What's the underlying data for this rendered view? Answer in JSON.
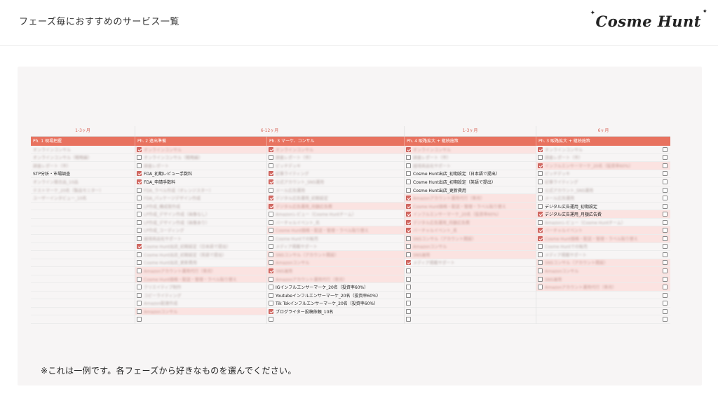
{
  "header": {
    "title": "フェーズ毎におすすめのサービス一覧",
    "logo": "Cosme Hunt",
    "sparkle": "✦"
  },
  "table": {
    "durations": [
      "1-3ヶ月",
      "6-12ヶ月",
      "1-3ヶ月",
      "6ヶ月"
    ],
    "phases": [
      "Ph. 1 現場把握",
      "Ph. 2 進出準備",
      "Ph. 3 マーケ、コンサル",
      "Ph. 4 販路拡大 + 継続施策",
      "Ph. 3 販路拡大 + 継続施策"
    ],
    "col1": [
      {
        "t": "オンラインコンサル",
        "b": true
      },
      {
        "t": "オンラインコンサル（戦略編）",
        "b": true
      },
      {
        "t": "調査レポート（市）",
        "b": true
      },
      {
        "t": "STP分析・市場調査",
        "b": false
      },
      {
        "t": "オンライン競合品_10品",
        "b": true
      },
      {
        "t": "テストマーケ_20名（製品モニター）",
        "b": true
      },
      {
        "t": "ユーザーインタビュー_10名",
        "b": true
      }
    ],
    "col2": [
      {
        "t": "オンラインコンサル",
        "b": true,
        "c": true,
        "h": true
      },
      {
        "t": "オンラインコンサル（戦略編）",
        "b": true,
        "c": false,
        "h": false
      },
      {
        "t": "調査レポート",
        "b": true,
        "c": false,
        "h": false
      },
      {
        "t": "FDA_初期レビュー手数料",
        "b": false,
        "c": true,
        "h": false
      },
      {
        "t": "FDA_申請手数料",
        "b": false,
        "c": true,
        "h": false
      },
      {
        "t": "FDA_ラベル作成（オレンジスター）",
        "b": true,
        "c": false,
        "h": false
      },
      {
        "t": "FDA_パッケージデザイン作成",
        "b": true,
        "c": false,
        "h": false
      },
      {
        "t": "LP作成_構成案作成",
        "b": true,
        "c": false,
        "h": false
      },
      {
        "t": "LP作成_デザイン作成（画像なし）",
        "b": true,
        "c": false,
        "h": false
      },
      {
        "t": "LP作成_デザイン作成（画像あり）",
        "b": true,
        "c": false,
        "h": false
      },
      {
        "t": "LP作成_コーディング",
        "b": true,
        "c": false,
        "h": false
      },
      {
        "t": "越境商品化サポート",
        "b": true,
        "c": false,
        "h": false
      },
      {
        "t": "Cosme Hunt出店_初期設定（日本語で提出）",
        "b": true,
        "c": true,
        "h": false
      },
      {
        "t": "Cosme Hunt出店_初期設定（英語で提出）",
        "b": true,
        "c": false,
        "h": false
      },
      {
        "t": "Cosme Hunt出店_更新費用",
        "b": true,
        "c": false,
        "h": false
      },
      {
        "t": "Amazonアカウント運用代行（単月）",
        "b": true,
        "c": false,
        "h": true
      },
      {
        "t": "Cosme Hunt価格・配送・管理・ラベル貼り替え",
        "b": true,
        "c": false,
        "h": true
      },
      {
        "t": "クリエイティブ制作",
        "b": true,
        "c": false,
        "h": false
      },
      {
        "t": "コピーライティング",
        "b": true,
        "c": false,
        "h": false
      },
      {
        "t": "Amazon配達作成",
        "b": true,
        "c": false,
        "h": false
      },
      {
        "t": "Amazonコンサル",
        "b": true,
        "c": false,
        "h": true
      }
    ],
    "col3": [
      {
        "t": "オンラインコンサル",
        "b": true,
        "c": true,
        "h": true
      },
      {
        "t": "調査レポート（市）",
        "b": true,
        "c": false,
        "h": false
      },
      {
        "t": "ピッチデッキ",
        "b": true,
        "c": false,
        "h": false
      },
      {
        "t": "記事ライティング",
        "b": true,
        "c": true,
        "h": false
      },
      {
        "t": "公式アカウント_SNS運用",
        "b": true,
        "c": true,
        "h": false
      },
      {
        "t": "メール広告運用",
        "b": true,
        "c": false,
        "h": false
      },
      {
        "t": "デジタル広告運用_初期設定",
        "b": true,
        "c": true,
        "h": false
      },
      {
        "t": "デジタル広告運用_月額広告費",
        "b": true,
        "c": true,
        "h": true
      },
      {
        "t": "Amazonレビュー（Cosme Huntチーム）",
        "b": true,
        "c": false,
        "h": false
      },
      {
        "t": "バーチャルイベント_名",
        "b": true,
        "c": false,
        "h": false
      },
      {
        "t": "Cosme Hunt価格・配送・管理・ラベル貼り替え",
        "b": true,
        "c": false,
        "h": true
      },
      {
        "t": "Cosme Huntでの販売",
        "b": true,
        "c": false,
        "h": false
      },
      {
        "t": "メディア掲載サポート",
        "b": true,
        "c": false,
        "h": false
      },
      {
        "t": "SNSコンサル（アカウント開設）",
        "b": true,
        "c": false,
        "h": true
      },
      {
        "t": "Amazonコンサル",
        "b": true,
        "c": false,
        "h": true
      },
      {
        "t": "SNS運用",
        "b": true,
        "c": true,
        "h": true
      },
      {
        "t": "Amazonアカウント運用代行（単月）",
        "b": true,
        "c": false,
        "h": true
      },
      {
        "t": "IGインフルエンサーマーケ_20名（投資率60%）",
        "b": false,
        "c": false,
        "h": false
      },
      {
        "t": "Youtubeインフルエンサーマーケ_20名（投資率60%）",
        "b": false,
        "c": false,
        "h": false
      },
      {
        "t": "Tik Tokインフルエンサーマーケ_20名（投資率60%）",
        "b": false,
        "c": false,
        "h": false
      },
      {
        "t": "ブログライター投稿依頼_10名",
        "b": false,
        "c": true,
        "h": false
      }
    ],
    "col4": [
      {
        "t": "オンラインコンサル",
        "b": true,
        "c": true,
        "h": true
      },
      {
        "t": "調査レポート（市）",
        "b": true,
        "c": false,
        "h": false
      },
      {
        "t": "越境商品化サポート",
        "b": true,
        "c": false,
        "h": false
      },
      {
        "t": "Cosme Hunt出店_初期設定（日本語で提出）",
        "b": false,
        "c": false,
        "h": false
      },
      {
        "t": "Cosme Hunt出店_初期設定（英語で提出）",
        "b": false,
        "c": false,
        "h": false
      },
      {
        "t": "Cosme Hunt出店_更新費用",
        "b": false,
        "c": false,
        "h": false
      },
      {
        "t": "Amazonアカウント運用代行（単月）",
        "b": true,
        "c": true,
        "h": true
      },
      {
        "t": "Cosme Hunt価格・配送・管理・ラベル貼り替え",
        "b": true,
        "c": true,
        "h": true
      },
      {
        "t": "インフルエンサーマーケ_20名（投資率60%）",
        "b": true,
        "c": true,
        "h": true
      },
      {
        "t": "デジタル広告運用_月額広告費",
        "b": true,
        "c": true,
        "h": true
      },
      {
        "t": "バーチャルイベント_名",
        "b": true,
        "c": true,
        "h": true
      },
      {
        "t": "SNSコンサル（アカウント開設）",
        "b": true,
        "c": false,
        "h": true
      },
      {
        "t": "Amazonコンサル",
        "b": true,
        "c": false,
        "h": true
      },
      {
        "t": "SNS運用",
        "b": true,
        "c": false,
        "h": true
      },
      {
        "t": "メディア掲載サポート",
        "b": true,
        "c": true,
        "h": false
      }
    ],
    "col5": [
      {
        "t": "オンラインコンサル",
        "b": true,
        "c": true,
        "h": false
      },
      {
        "t": "調査レポート（市）",
        "b": true,
        "c": false,
        "h": false
      },
      {
        "t": "インフルエンサーマーケ_20名（投資率60%）",
        "b": true,
        "c": true,
        "h": true
      },
      {
        "t": "ピッチデッキ",
        "b": true,
        "c": false,
        "h": false
      },
      {
        "t": "記事ライティング",
        "b": true,
        "c": false,
        "h": false
      },
      {
        "t": "公式アカウント_SNS運用",
        "b": true,
        "c": false,
        "h": false
      },
      {
        "t": "メール広告運用",
        "b": true,
        "c": false,
        "h": false
      },
      {
        "t": "デジタル広告運用_初期設定",
        "b": false,
        "c": false,
        "h": false
      },
      {
        "t": "デジタル広告運用_月額広告費",
        "b": false,
        "c": true,
        "h": true
      },
      {
        "t": "Amazonレビュー（Cosme Huntチーム）",
        "b": true,
        "c": false,
        "h": false
      },
      {
        "t": "バーチャルイベント",
        "b": true,
        "c": true,
        "h": true
      },
      {
        "t": "Cosme Hunt価格・配送・管理・ラベル貼り替え",
        "b": true,
        "c": true,
        "h": true
      },
      {
        "t": "Cosme Huntでの販売",
        "b": true,
        "c": false,
        "h": false
      },
      {
        "t": "メディア掲載サポート",
        "b": true,
        "c": false,
        "h": false
      },
      {
        "t": "SNSコンサル（アカウント開設）",
        "b": true,
        "c": false,
        "h": true
      },
      {
        "t": "Amazonコンサル",
        "b": true,
        "c": false,
        "h": true
      },
      {
        "t": "SNS運用",
        "b": true,
        "c": false,
        "h": true
      },
      {
        "t": "Amazonアカウント運用代行（単月）",
        "b": true,
        "c": false,
        "h": true
      }
    ]
  },
  "footer": {
    "note": "※これは一例です。各フェーズから好きなものを選んでください。"
  }
}
